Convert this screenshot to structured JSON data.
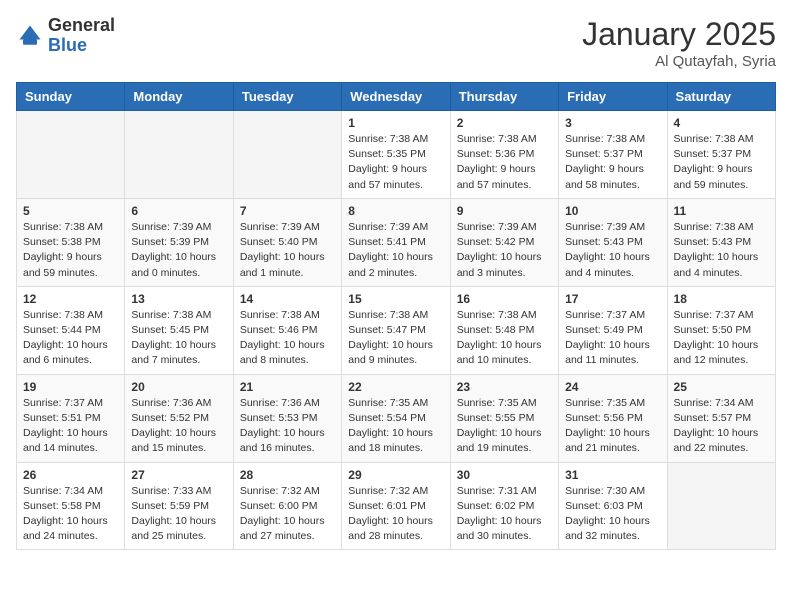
{
  "header": {
    "logo": {
      "general": "General",
      "blue": "Blue"
    },
    "title": "January 2025",
    "subtitle": "Al Qutayfah, Syria"
  },
  "days_of_week": [
    "Sunday",
    "Monday",
    "Tuesday",
    "Wednesday",
    "Thursday",
    "Friday",
    "Saturday"
  ],
  "weeks": [
    {
      "days": [
        {
          "num": "",
          "info": ""
        },
        {
          "num": "",
          "info": ""
        },
        {
          "num": "",
          "info": ""
        },
        {
          "num": "1",
          "info": "Sunrise: 7:38 AM\nSunset: 5:35 PM\nDaylight: 9 hours\nand 57 minutes."
        },
        {
          "num": "2",
          "info": "Sunrise: 7:38 AM\nSunset: 5:36 PM\nDaylight: 9 hours\nand 57 minutes."
        },
        {
          "num": "3",
          "info": "Sunrise: 7:38 AM\nSunset: 5:37 PM\nDaylight: 9 hours\nand 58 minutes."
        },
        {
          "num": "4",
          "info": "Sunrise: 7:38 AM\nSunset: 5:37 PM\nDaylight: 9 hours\nand 59 minutes."
        }
      ]
    },
    {
      "days": [
        {
          "num": "5",
          "info": "Sunrise: 7:38 AM\nSunset: 5:38 PM\nDaylight: 9 hours\nand 59 minutes."
        },
        {
          "num": "6",
          "info": "Sunrise: 7:39 AM\nSunset: 5:39 PM\nDaylight: 10 hours\nand 0 minutes."
        },
        {
          "num": "7",
          "info": "Sunrise: 7:39 AM\nSunset: 5:40 PM\nDaylight: 10 hours\nand 1 minute."
        },
        {
          "num": "8",
          "info": "Sunrise: 7:39 AM\nSunset: 5:41 PM\nDaylight: 10 hours\nand 2 minutes."
        },
        {
          "num": "9",
          "info": "Sunrise: 7:39 AM\nSunset: 5:42 PM\nDaylight: 10 hours\nand 3 minutes."
        },
        {
          "num": "10",
          "info": "Sunrise: 7:39 AM\nSunset: 5:43 PM\nDaylight: 10 hours\nand 4 minutes."
        },
        {
          "num": "11",
          "info": "Sunrise: 7:38 AM\nSunset: 5:43 PM\nDaylight: 10 hours\nand 4 minutes."
        }
      ]
    },
    {
      "days": [
        {
          "num": "12",
          "info": "Sunrise: 7:38 AM\nSunset: 5:44 PM\nDaylight: 10 hours\nand 6 minutes."
        },
        {
          "num": "13",
          "info": "Sunrise: 7:38 AM\nSunset: 5:45 PM\nDaylight: 10 hours\nand 7 minutes."
        },
        {
          "num": "14",
          "info": "Sunrise: 7:38 AM\nSunset: 5:46 PM\nDaylight: 10 hours\nand 8 minutes."
        },
        {
          "num": "15",
          "info": "Sunrise: 7:38 AM\nSunset: 5:47 PM\nDaylight: 10 hours\nand 9 minutes."
        },
        {
          "num": "16",
          "info": "Sunrise: 7:38 AM\nSunset: 5:48 PM\nDaylight: 10 hours\nand 10 minutes."
        },
        {
          "num": "17",
          "info": "Sunrise: 7:37 AM\nSunset: 5:49 PM\nDaylight: 10 hours\nand 11 minutes."
        },
        {
          "num": "18",
          "info": "Sunrise: 7:37 AM\nSunset: 5:50 PM\nDaylight: 10 hours\nand 12 minutes."
        }
      ]
    },
    {
      "days": [
        {
          "num": "19",
          "info": "Sunrise: 7:37 AM\nSunset: 5:51 PM\nDaylight: 10 hours\nand 14 minutes."
        },
        {
          "num": "20",
          "info": "Sunrise: 7:36 AM\nSunset: 5:52 PM\nDaylight: 10 hours\nand 15 minutes."
        },
        {
          "num": "21",
          "info": "Sunrise: 7:36 AM\nSunset: 5:53 PM\nDaylight: 10 hours\nand 16 minutes."
        },
        {
          "num": "22",
          "info": "Sunrise: 7:35 AM\nSunset: 5:54 PM\nDaylight: 10 hours\nand 18 minutes."
        },
        {
          "num": "23",
          "info": "Sunrise: 7:35 AM\nSunset: 5:55 PM\nDaylight: 10 hours\nand 19 minutes."
        },
        {
          "num": "24",
          "info": "Sunrise: 7:35 AM\nSunset: 5:56 PM\nDaylight: 10 hours\nand 21 minutes."
        },
        {
          "num": "25",
          "info": "Sunrise: 7:34 AM\nSunset: 5:57 PM\nDaylight: 10 hours\nand 22 minutes."
        }
      ]
    },
    {
      "days": [
        {
          "num": "26",
          "info": "Sunrise: 7:34 AM\nSunset: 5:58 PM\nDaylight: 10 hours\nand 24 minutes."
        },
        {
          "num": "27",
          "info": "Sunrise: 7:33 AM\nSunset: 5:59 PM\nDaylight: 10 hours\nand 25 minutes."
        },
        {
          "num": "28",
          "info": "Sunrise: 7:32 AM\nSunset: 6:00 PM\nDaylight: 10 hours\nand 27 minutes."
        },
        {
          "num": "29",
          "info": "Sunrise: 7:32 AM\nSunset: 6:01 PM\nDaylight: 10 hours\nand 28 minutes."
        },
        {
          "num": "30",
          "info": "Sunrise: 7:31 AM\nSunset: 6:02 PM\nDaylight: 10 hours\nand 30 minutes."
        },
        {
          "num": "31",
          "info": "Sunrise: 7:30 AM\nSunset: 6:03 PM\nDaylight: 10 hours\nand 32 minutes."
        },
        {
          "num": "",
          "info": ""
        }
      ]
    }
  ]
}
